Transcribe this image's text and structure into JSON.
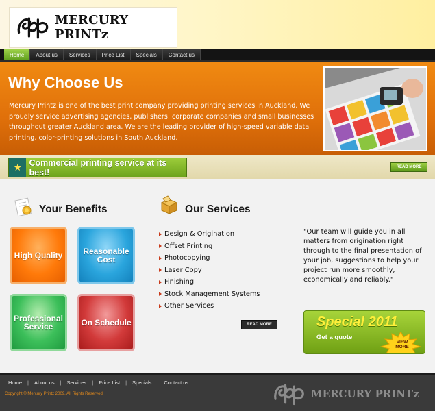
{
  "header": {
    "logo_text": "MERCURY PRINTz"
  },
  "nav": {
    "items": [
      "Home",
      "About us",
      "Services",
      "Price List",
      "Specials",
      "Contact us"
    ],
    "active": "Home"
  },
  "hero": {
    "title": "Why Choose Us",
    "text": "Mercury Printz is one of the best print company providing printing services in Auckland. We proudly service advertising agencies, publishers, corporate companies and small businesses throughout greater Auckland area. We are the leading provider of high-speed variable data printing, color-printing solutions in South Auckland.",
    "photo_icon": "printing-press-photo"
  },
  "banner": {
    "text": "Commercial printing service at its best!",
    "read_more": "READ MORE",
    "icon": "star-icon"
  },
  "benefits": {
    "title": "Your Benefits",
    "icon": "certificate-icon",
    "tiles": [
      "High Quality",
      "Reasonable Cost",
      "Professional Service",
      "On Schedule"
    ]
  },
  "services": {
    "title": "Our Services",
    "icon": "box-icon",
    "items": [
      "Design & Origination",
      "Offset Printing",
      "Photocopying",
      "Laser Copy",
      "Finishing",
      "Stock Management Systems",
      "Other Services"
    ],
    "read_more": "READ MORE"
  },
  "quote": {
    "text": "\"Our team will guide you in all matters from origination right through to the final presentation of your job, suggestions to help your project run more smoothly, economically and reliably.\""
  },
  "special": {
    "title": "Special 2011",
    "subtitle": "Get a quote",
    "badge": "VIEW MORE"
  },
  "footer": {
    "nav": [
      "Home",
      "About us",
      "Services",
      "Price List",
      "Specials",
      "Contact us"
    ],
    "copyright": "Copyright © Mercury Printz 2009. All Rights Reserved.",
    "logo_text": "MERCURY PRINTz"
  },
  "colors": {
    "accent_orange": "#e0700a",
    "accent_green": "#7fb52a",
    "nav_bg": "#141414",
    "footer_bg": "#3a3a3a"
  }
}
